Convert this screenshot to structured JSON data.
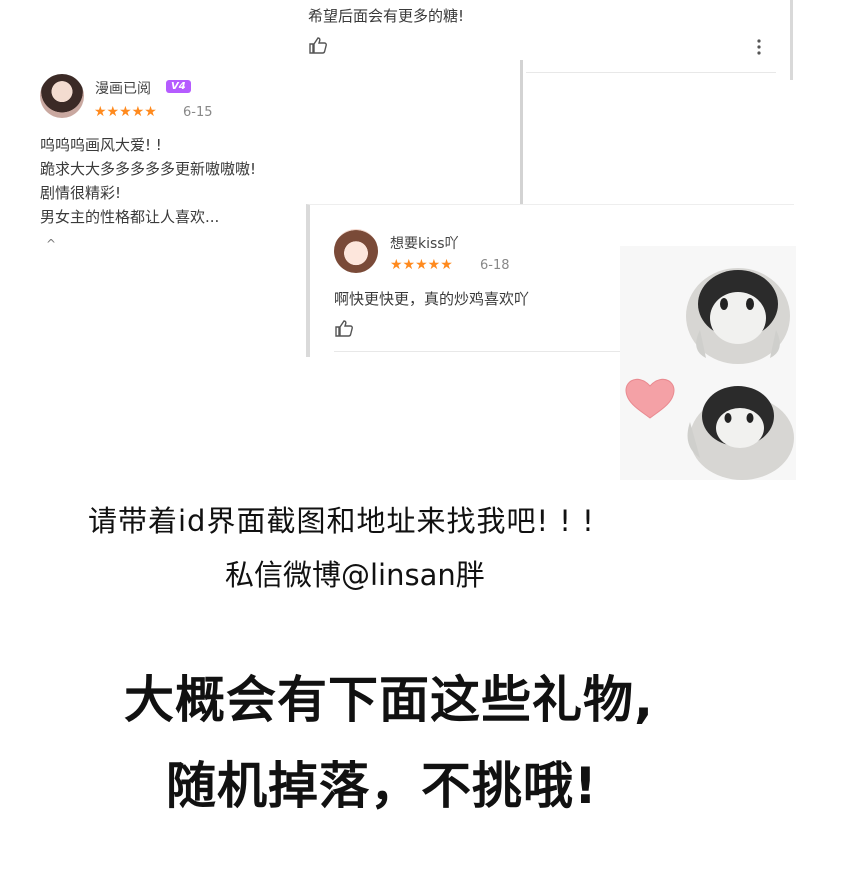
{
  "comments": {
    "top": {
      "text": "希望后面会有更多的糖!"
    },
    "left": {
      "username": "漫画已阅",
      "vip_badge": "V4",
      "stars": "★★★★★",
      "date": "6-15",
      "lines": [
        "呜呜呜画风大爱! !",
        "跪求大大多多多多多更新嗷嗷嗷!",
        "剧情很精彩!",
        "男女主的性格都让人喜欢..."
      ],
      "expand": "^"
    },
    "bottom": {
      "username": "想要kiss吖",
      "stars": "★★★★★",
      "date": "6-18",
      "text": "啊快更快更，真的炒鸡喜欢吖"
    }
  },
  "notice": {
    "line1": "请带着id界面截图和地址来找我吧! ! !",
    "line2": "私信微博@linsan胖"
  },
  "headline": {
    "line1": "大概会有下面这些礼物,",
    "line2": "随机掉落，不挑哦!"
  },
  "colors": {
    "star": "#ff8a1e",
    "vip": "#b55cff",
    "heart": "#f4a1a6"
  },
  "icons": [
    "thumbs-up-icon",
    "more-options-icon",
    "heart-icon",
    "penguin-sticker"
  ]
}
